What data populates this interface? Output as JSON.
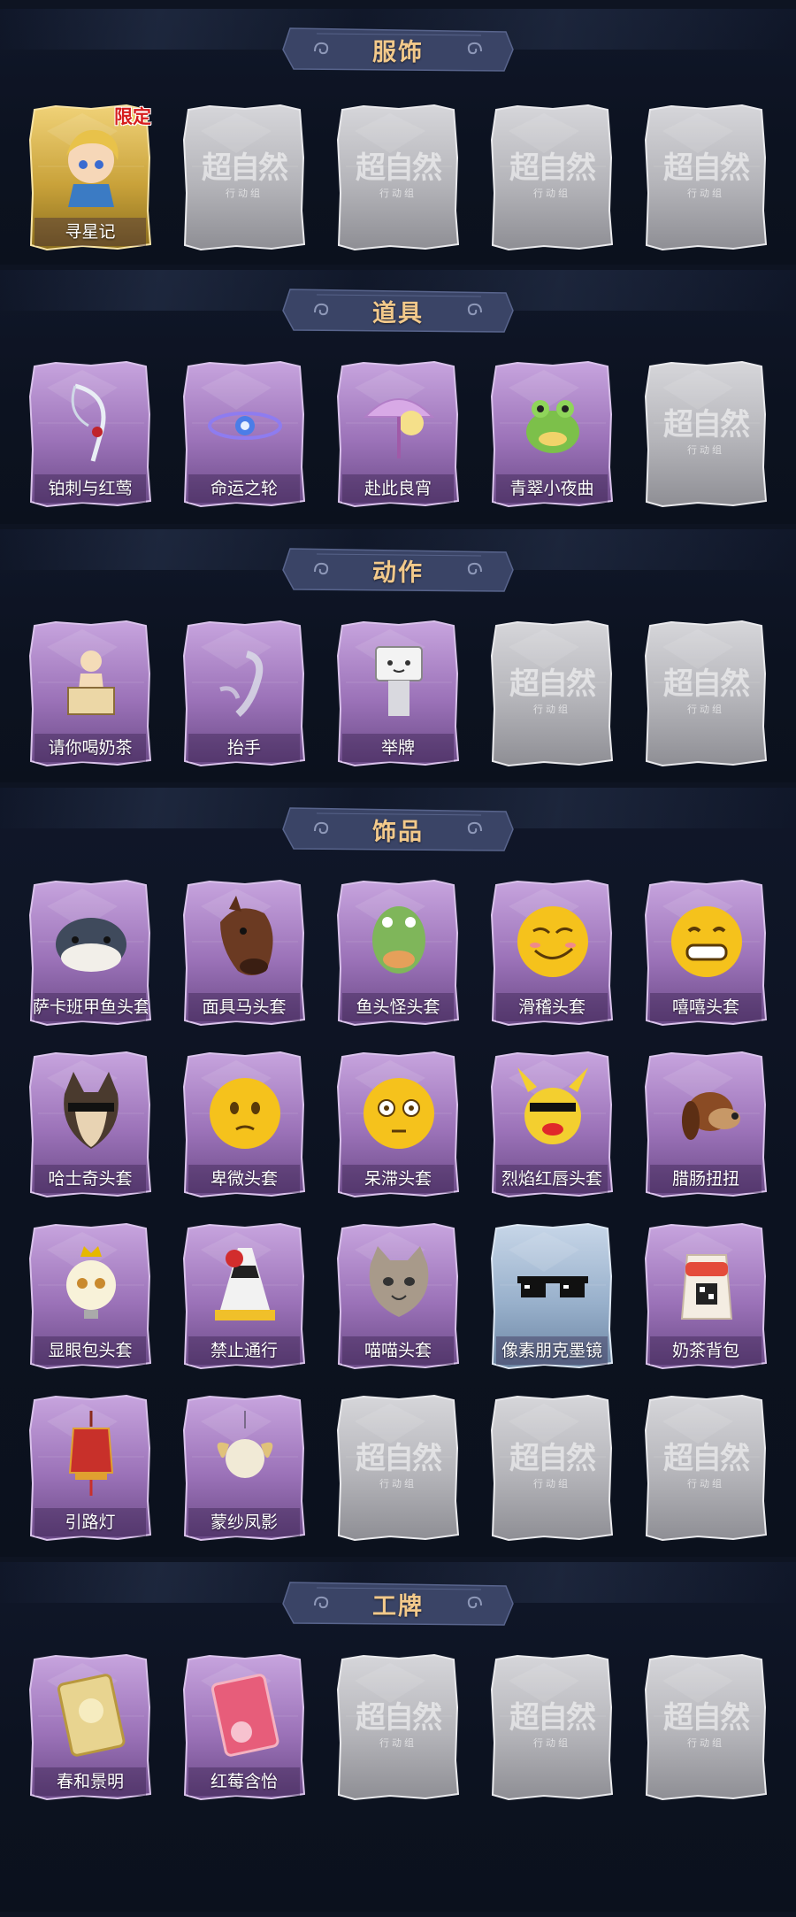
{
  "sections": [
    {
      "title": "服饰",
      "rows": [
        [
          {
            "label": "寻星记",
            "style": "gold",
            "icon": "chibi-character-icon",
            "badge": "限定"
          },
          {
            "label": "",
            "style": "locked",
            "icon": "locked-placeholder-icon"
          },
          {
            "label": "",
            "style": "locked",
            "icon": "locked-placeholder-icon"
          },
          {
            "label": "",
            "style": "locked",
            "icon": "locked-placeholder-icon"
          },
          {
            "label": "",
            "style": "locked",
            "icon": "locked-placeholder-icon"
          }
        ]
      ]
    },
    {
      "title": "道具",
      "rows": [
        [
          {
            "label": "铂刺与红莺",
            "style": "purple",
            "icon": "scythe-icon"
          },
          {
            "label": "命运之轮",
            "style": "purple",
            "icon": "wheel-icon"
          },
          {
            "label": "赴此良宵",
            "style": "purple",
            "icon": "lantern-umbrella-icon"
          },
          {
            "label": "青翠小夜曲",
            "style": "purple",
            "icon": "frog-icon"
          },
          {
            "label": "",
            "style": "locked",
            "icon": "locked-placeholder-icon"
          }
        ]
      ]
    },
    {
      "title": "动作",
      "rows": [
        [
          {
            "label": "请你喝奶茶",
            "style": "purple",
            "icon": "person-sign-icon"
          },
          {
            "label": "抬手",
            "style": "purple",
            "icon": "raise-hand-icon"
          },
          {
            "label": "举牌",
            "style": "purple",
            "icon": "hold-sign-icon"
          },
          {
            "label": "",
            "style": "locked",
            "icon": "locked-placeholder-icon"
          },
          {
            "label": "",
            "style": "locked",
            "icon": "locked-placeholder-icon"
          }
        ]
      ]
    },
    {
      "title": "饰品",
      "rows": [
        [
          {
            "label": "萨卡班甲鱼头套",
            "style": "purple",
            "icon": "fish-head-icon"
          },
          {
            "label": "面具马头套",
            "style": "purple",
            "icon": "horse-head-icon"
          },
          {
            "label": "鱼头怪头套",
            "style": "purple",
            "icon": "fish-monster-icon"
          },
          {
            "label": "滑稽头套",
            "style": "purple",
            "icon": "smirk-emoji-icon"
          },
          {
            "label": "嘻嘻头套",
            "style": "purple",
            "icon": "grin-emoji-icon"
          }
        ],
        [
          {
            "label": "哈士奇头套",
            "style": "purple",
            "icon": "husky-head-icon"
          },
          {
            "label": "卑微头套",
            "style": "purple",
            "icon": "pleading-emoji-icon"
          },
          {
            "label": "呆滞头套",
            "style": "purple",
            "icon": "flushed-emoji-icon"
          },
          {
            "label": "烈焰红唇头套",
            "style": "purple",
            "icon": "pikachu-lips-icon"
          },
          {
            "label": "腊肠扭扭",
            "style": "purple",
            "icon": "dachshund-icon"
          }
        ],
        [
          {
            "label": "显眼包头套",
            "style": "purple",
            "icon": "bulb-head-icon"
          },
          {
            "label": "禁止通行",
            "style": "purple",
            "icon": "traffic-cone-icon"
          },
          {
            "label": "喵喵头套",
            "style": "purple",
            "icon": "cat-head-icon"
          },
          {
            "label": "像素朋克墨镜",
            "style": "blue",
            "icon": "pixel-sunglasses-icon"
          },
          {
            "label": "奶茶背包",
            "style": "purple",
            "icon": "milk-tea-backpack-icon"
          }
        ],
        [
          {
            "label": "引路灯",
            "style": "purple",
            "icon": "red-lantern-icon"
          },
          {
            "label": "蒙纱凤影",
            "style": "purple",
            "icon": "phoenix-charm-icon"
          },
          {
            "label": "",
            "style": "locked",
            "icon": "locked-placeholder-icon"
          },
          {
            "label": "",
            "style": "locked",
            "icon": "locked-placeholder-icon"
          },
          {
            "label": "",
            "style": "locked",
            "icon": "locked-placeholder-icon"
          }
        ]
      ]
    },
    {
      "title": "工牌",
      "rows": [
        [
          {
            "label": "春和景明",
            "style": "purple",
            "icon": "gold-badge-icon"
          },
          {
            "label": "红莓含怡",
            "style": "purple",
            "icon": "pink-badge-icon"
          },
          {
            "label": "",
            "style": "locked",
            "icon": "locked-placeholder-icon"
          },
          {
            "label": "",
            "style": "locked",
            "icon": "locked-placeholder-icon"
          },
          {
            "label": "",
            "style": "locked",
            "icon": "locked-placeholder-icon"
          }
        ]
      ]
    }
  ],
  "locked_placeholder": {
    "big": "超自然",
    "small": "行动组"
  },
  "colors": {
    "background": "#0e1422",
    "banner": "#3a4466",
    "banner_title": "#f2c98b",
    "purple_card": "#9a74b6",
    "gold_card": "#c9a23a",
    "blue_card": "#8fa8c4",
    "locked_card": "#b9b9bd",
    "limited_badge": "#d61d1d"
  }
}
